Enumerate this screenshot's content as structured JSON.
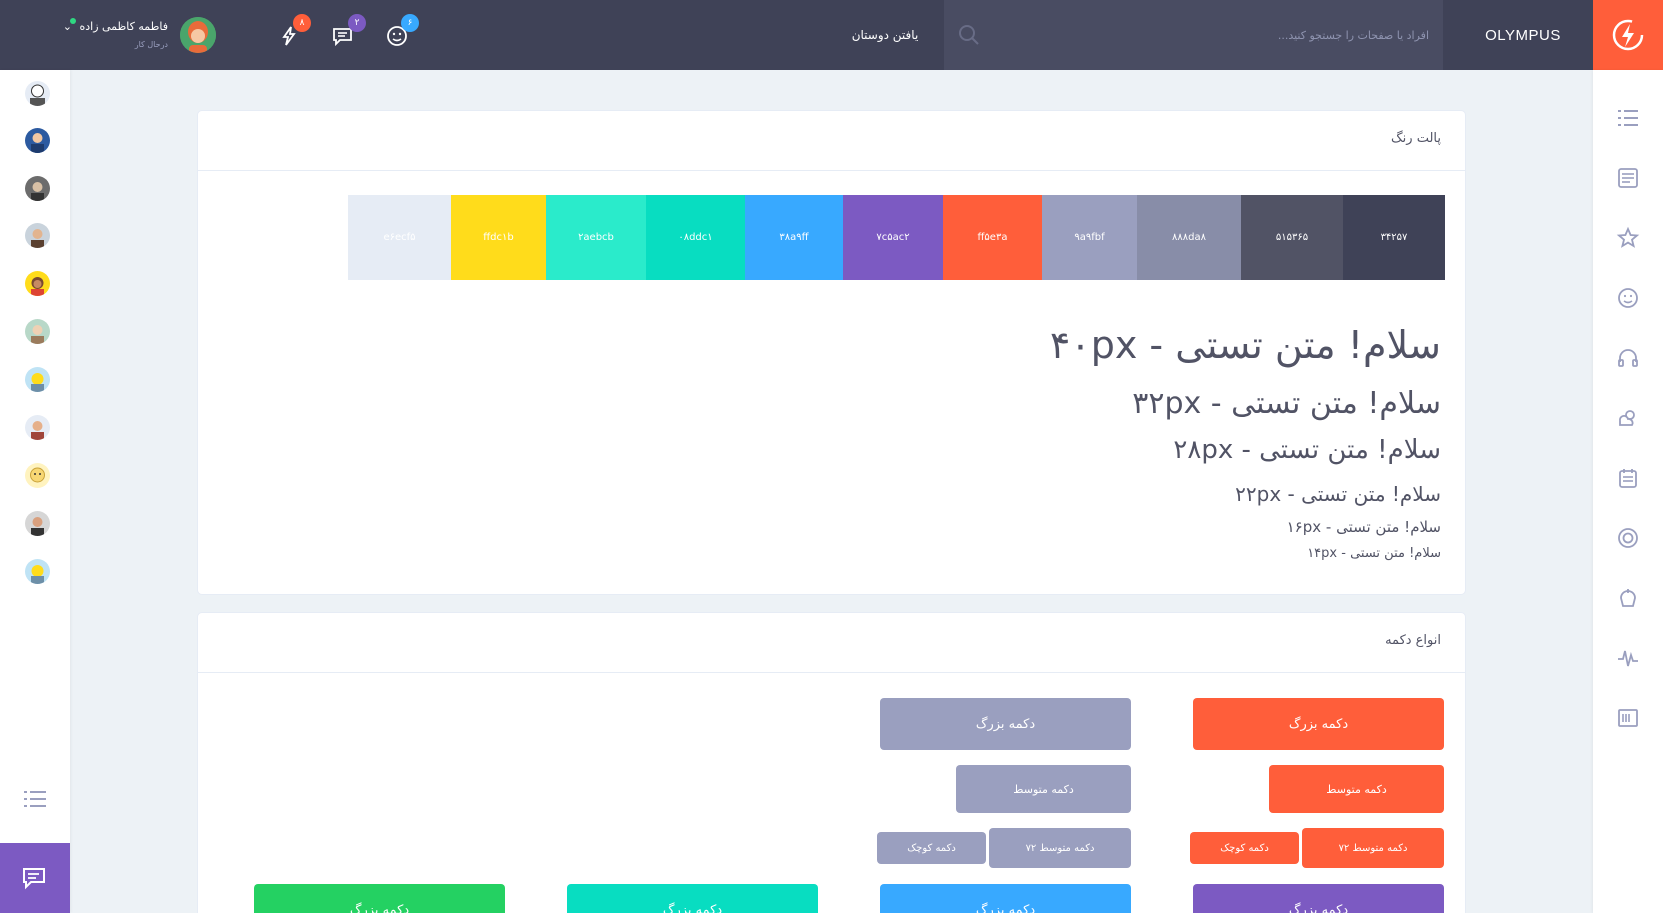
{
  "header": {
    "brand_name": "OLYMPUS",
    "search_placeholder": "افراد یا صفحات را جستجو کنید...",
    "find_friends": "یافتن دوستان",
    "badges": {
      "friends": "۶",
      "messages": "۲",
      "notifications": "۸"
    },
    "user": {
      "name": "فاطمه کاظمی زاده",
      "caret": "⌄",
      "status": "درحال کار"
    }
  },
  "palette_card": {
    "title": "پالت رنگ",
    "swatches": [
      {
        "label": "۳۴۲۵۷",
        "color": "#3f4257",
        "text_color": "#ffffff"
      },
      {
        "label": "۵۱۵۳۶۵",
        "color": "#515365",
        "text_color": "#ffffff"
      },
      {
        "label": "۸۸۸da۸",
        "color": "#888da8",
        "text_color": "#ffffff"
      },
      {
        "label": "۹a۹fbf",
        "color": "#9a9fbf",
        "text_color": "#ffffff"
      },
      {
        "label": "ff۵e۳a",
        "color": "#ff5e3a",
        "text_color": "#ffffff"
      },
      {
        "label": "۷c۵ac۲",
        "color": "#7c5ac2",
        "text_color": "#ffffff"
      },
      {
        "label": "۳۸a۹ff",
        "color": "#38a9ff",
        "text_color": "#ffffff"
      },
      {
        "label": "۰۸ddc۱",
        "color": "#08ddc1",
        "text_color": "#ffffff"
      },
      {
        "label": "۲aebcb",
        "color": "#2aebcb",
        "text_color": "#ffffff"
      },
      {
        "label": "ffdc۱b",
        "color": "#ffdc1b",
        "text_color": "#ffffff"
      },
      {
        "label": "e۶ecf۵",
        "color": "#e6ecf5",
        "text_color": "#ffffff"
      }
    ],
    "type_samples": [
      "سلام! متن تستی - ۴۰px",
      "سلام! متن تستی - ۳۲px",
      "سلام! متن تستی - ۲۸px",
      "سلام! متن تستی - ۲۲px",
      "سلام! متن تستی - ۱۶px",
      "سلام! متن تستی - ۱۴px"
    ]
  },
  "buttons_card": {
    "title": "انواع دکمه",
    "large": "دکمه بزرگ",
    "medium": "دکمه متوسط",
    "medium72": "دکمه متوسط ۷۲",
    "small": "دکمه کوچک"
  },
  "colors": {
    "primary": "#ff5e3a",
    "secondary": "#9a9fbf",
    "purple": "#7c5ac2",
    "blue": "#38a9ff",
    "teal": "#08ddc1",
    "green": "#24d162",
    "header_bg": "#3f4257"
  }
}
